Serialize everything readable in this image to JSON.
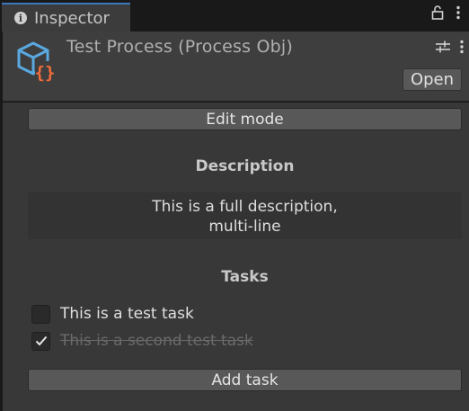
{
  "tab": {
    "label": "Inspector",
    "icon": "info-icon"
  },
  "header": {
    "title": "Test Process (Process Obj)",
    "open_label": "Open"
  },
  "edit_mode_label": "Edit mode",
  "description": {
    "title": "Description",
    "line1": "This is a full description,",
    "line2": "multi-line"
  },
  "tasks": {
    "title": "Tasks",
    "items": [
      {
        "label": "This is a test task",
        "checked": false
      },
      {
        "label": "This is a second test task",
        "checked": true
      }
    ],
    "add_label": "Add task"
  }
}
